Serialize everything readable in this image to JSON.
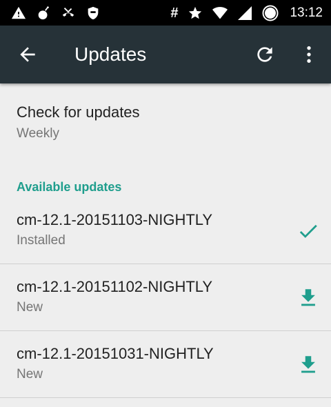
{
  "status_bar": {
    "icons_left": [
      "warning-icon",
      "bomb-icon",
      "missed-call-icon",
      "shield-icon"
    ],
    "hash_symbol": "#",
    "icons_right": [
      "star-icon",
      "wifi-icon",
      "signal-icon",
      "battery-icon"
    ],
    "battery_level": "68",
    "time": "13:12"
  },
  "toolbar": {
    "title": "Updates",
    "back_icon": "arrow-back-icon",
    "refresh_icon": "refresh-icon",
    "more_icon": "more-vert-icon",
    "background_color": "#263238"
  },
  "check_updates": {
    "title": "Check for updates",
    "summary": "Weekly"
  },
  "available_updates": {
    "header": "Available updates",
    "accent_color": "#1f9e8d",
    "items": [
      {
        "name": "cm-12.1-20151103-NIGHTLY",
        "status": "Installed",
        "action_icon": "check-icon"
      },
      {
        "name": "cm-12.1-20151102-NIGHTLY",
        "status": "New",
        "action_icon": "download-icon"
      },
      {
        "name": "cm-12.1-20151031-NIGHTLY",
        "status": "New",
        "action_icon": "download-icon"
      }
    ]
  }
}
